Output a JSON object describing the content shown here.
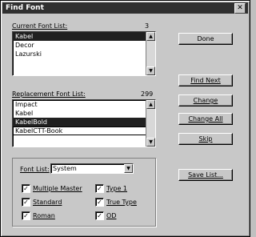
{
  "window": {
    "title": "Find Font",
    "close_glyph": "✕"
  },
  "current_list": {
    "label": "Current Font List:",
    "count": "3",
    "items": [
      "Kabel",
      "Decor",
      "Lazurski"
    ],
    "selected_index": 0
  },
  "replacement_list": {
    "label": "Replacement Font List:",
    "count": "299",
    "items": [
      "Impact",
      "Kabel",
      "KabelBold",
      "KabelCTT-Book"
    ],
    "selected_index": 2,
    "focused_index": 3
  },
  "buttons": {
    "done": "Done",
    "find_next": "Find Next",
    "change": "Change",
    "change_all": "Change All",
    "skip": "Skip",
    "save_list": "Save List..."
  },
  "filter": {
    "label": "Font List:",
    "value": "System"
  },
  "checkboxes": [
    {
      "label": "Multiple Master",
      "checked": true
    },
    {
      "label": "Type 1",
      "checked": true
    },
    {
      "label": "Standard",
      "checked": true
    },
    {
      "label": "True Type",
      "checked": true
    },
    {
      "label": "Roman",
      "checked": true
    },
    {
      "label": "OD",
      "checked": true
    }
  ],
  "glyphs": {
    "scroll_up": "▲",
    "scroll_down": "▼",
    "dropdown": "▼",
    "check": "✓"
  }
}
